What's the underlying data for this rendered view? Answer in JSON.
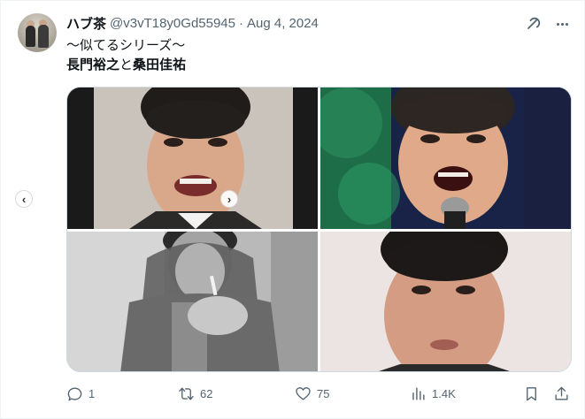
{
  "tweet": {
    "display_name": "ハブ茶",
    "handle": "@v3vT18y0Gd55945",
    "separator": "·",
    "date": "Aug 4, 2024",
    "text_line1": "〜似てるシリーズ〜",
    "text_line2_part1": "長門裕之",
    "text_line2_join": "と",
    "text_line2_part2": "桑田佳祐"
  },
  "media": {
    "images": [
      {
        "icon": "photo-portrait-smiling-man"
      },
      {
        "icon": "photo-singer-with-microphone"
      },
      {
        "icon": "photo-bw-man-lighting-cigarette"
      },
      {
        "icon": "photo-man-closeup-portrait"
      }
    ],
    "nav_prev": "‹",
    "nav_next": "›"
  },
  "actions": {
    "reply_count": "1",
    "retweet_count": "62",
    "like_count": "75",
    "views_count": "1.4K"
  },
  "colors": {
    "text_primary": "#0f1419",
    "text_secondary": "#536471",
    "border": "#cfd9de"
  }
}
